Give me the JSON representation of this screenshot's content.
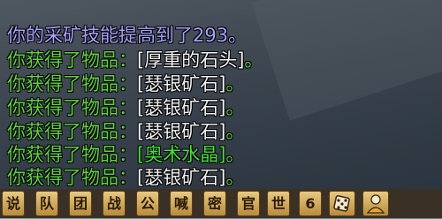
{
  "chat": {
    "lines": [
      {
        "type": "skill",
        "text": "你的采矿技能提高到了293。"
      },
      {
        "type": "loot",
        "prefix": "你获得了物品：",
        "item": "[厚重的石头]",
        "suffix": "。"
      },
      {
        "type": "loot",
        "prefix": "你获得了物品：",
        "item": "[瑟银矿石]",
        "suffix": "。"
      },
      {
        "type": "loot",
        "prefix": "你获得了物品：",
        "item": "[瑟银矿石]",
        "suffix": "。"
      },
      {
        "type": "loot",
        "prefix": "你获得了物品：",
        "item": "[瑟银矿石]",
        "suffix": "。"
      },
      {
        "type": "loot",
        "prefix": "你获得了物品：",
        "item": "[奥术水晶]",
        "suffix": "。"
      },
      {
        "type": "loot",
        "prefix": "你获得了物品：",
        "item": "[瑟银矿石]",
        "suffix": "。"
      }
    ]
  },
  "channel_bar": {
    "tabs": [
      "说",
      "队",
      "团",
      "战",
      "公",
      "喊",
      "密",
      "官",
      "世",
      "6"
    ],
    "icons": [
      "dice-icon",
      "character-icon"
    ]
  },
  "colors": {
    "skill_text": "#a8a0ff",
    "loot_prefix": "#5fd23f",
    "item_common": "#f2f2f2",
    "item_uncommon": "#45e03a"
  }
}
